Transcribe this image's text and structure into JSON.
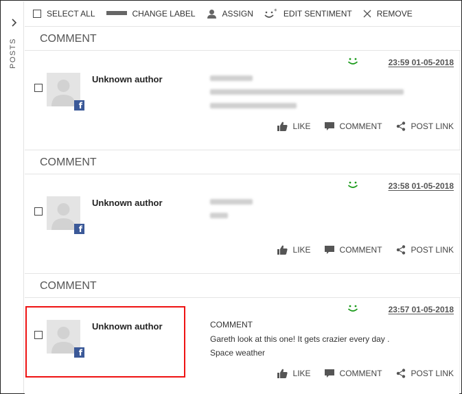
{
  "rail": {
    "label": "POSTS",
    "expand_icon": "chevron-right-icon"
  },
  "toolbar": {
    "select_all": "SELECT ALL",
    "change_label": "CHANGE LABEL",
    "assign": "ASSIGN",
    "edit_sentiment": "EDIT SENTIMENT",
    "remove": "REMOVE"
  },
  "colors": {
    "sentiment_positive": "#1a9a1a",
    "facebook": "#3b5998",
    "highlight": "#e11111"
  },
  "posts": [
    {
      "section_label": "COMMENT",
      "author": "Unknown author",
      "source_icon": "facebook-icon",
      "sentiment": "positive",
      "timestamp": "23:59 01-05-2018",
      "actions": {
        "like": "LIKE",
        "comment": "COMMENT",
        "post_link": "POST LINK"
      }
    },
    {
      "section_label": "COMMENT",
      "author": "Unknown author",
      "source_icon": "facebook-icon",
      "sentiment": "positive",
      "timestamp": "23:58 01-05-2018",
      "actions": {
        "like": "LIKE",
        "comment": "COMMENT",
        "post_link": "POST LINK"
      }
    },
    {
      "section_label": "COMMENT",
      "author": "Unknown author",
      "source_icon": "facebook-icon",
      "sentiment": "positive",
      "timestamp": "23:57 01-05-2018",
      "body_type": "COMMENT",
      "body_lines": [
        "Gareth look at this one! It gets crazier every day .",
        "Space weather"
      ],
      "actions": {
        "like": "LIKE",
        "comment": "COMMENT",
        "post_link": "POST LINK"
      }
    }
  ]
}
